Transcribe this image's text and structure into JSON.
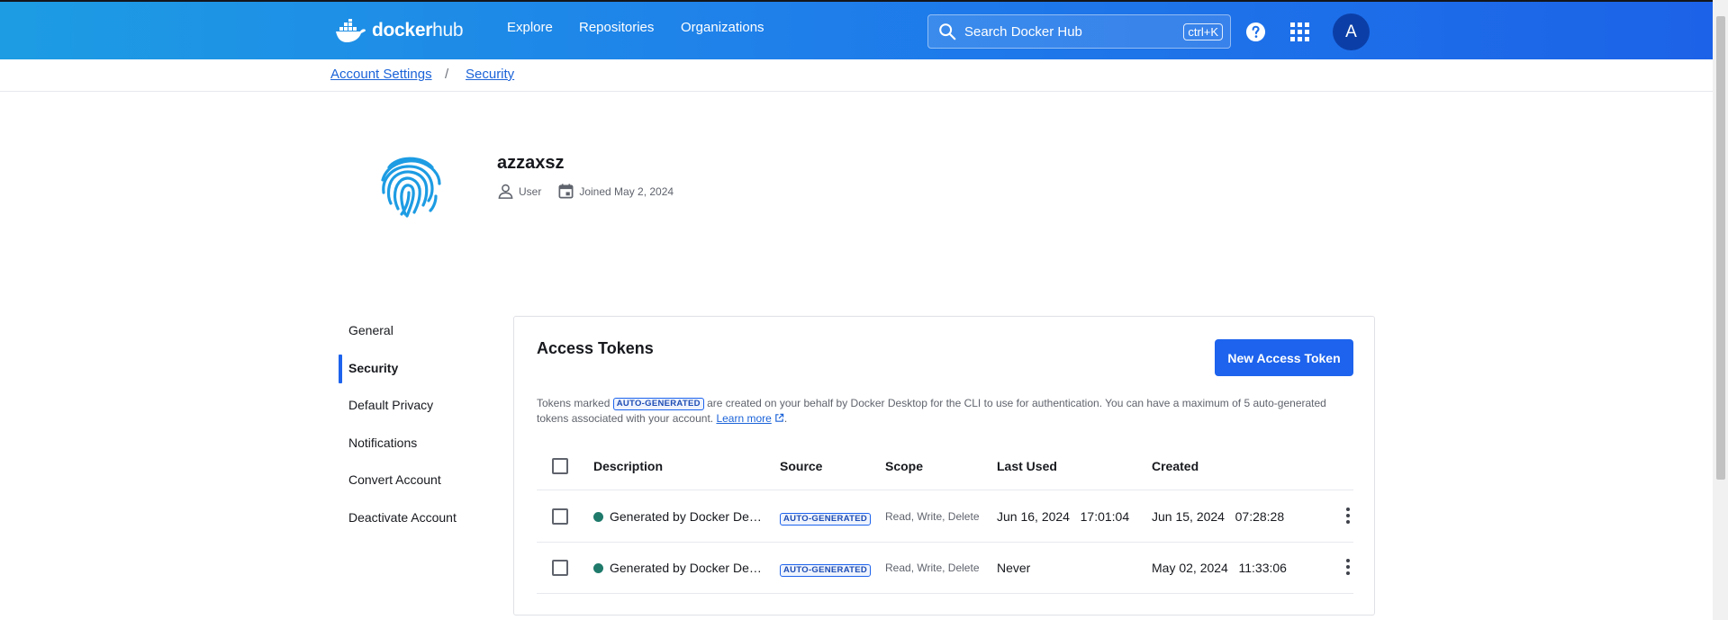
{
  "header": {
    "logo_text_1": "docker",
    "logo_text_2": "hub",
    "nav": [
      "Explore",
      "Repositories",
      "Organizations"
    ],
    "search_placeholder": "Search Docker Hub",
    "search_shortcut": "ctrl+K",
    "avatar_initial": "A",
    "icons": [
      "docker-whale-icon",
      "search-icon",
      "help-icon",
      "apps-grid-icon"
    ]
  },
  "breadcrumb": {
    "items": [
      "Account Settings",
      "Security"
    ],
    "separator": "/"
  },
  "profile": {
    "username": "azzaxsz",
    "role": "User",
    "joined": "Joined May 2, 2024",
    "icons": [
      "fingerprint-icon",
      "user-icon",
      "calendar-icon"
    ]
  },
  "sidebar": {
    "items": [
      "General",
      "Security",
      "Default Privacy",
      "Notifications",
      "Convert Account",
      "Deactivate Account"
    ],
    "active": "Security"
  },
  "tokens": {
    "title": "Access Tokens",
    "new_button": "New Access Token",
    "info_before": "Tokens marked",
    "badge": "AUTO-GENERATED",
    "info_after": "are created on your behalf by Docker Desktop for the CLI to use for authentication. You can have a maximum of 5 auto-generated tokens associated with your account.",
    "learn_more": "Learn more",
    "info_end": ".",
    "columns": [
      "Description",
      "Source",
      "Scope",
      "Last Used",
      "Created"
    ],
    "rows": [
      {
        "description": "Generated by Docker De…",
        "source": "AUTO-GENERATED",
        "scope": "Read, Write, Delete",
        "last_used": "Jun 16, 2024   17:01:04",
        "created": "Jun 15, 2024   07:28:28"
      },
      {
        "description": "Generated by Docker De…",
        "source": "AUTO-GENERATED",
        "scope": "Read, Write, Delete",
        "last_used": "Never",
        "created": "May 02, 2024   11:33:06"
      }
    ]
  },
  "colors": {
    "primary": "#1d63ed",
    "header_gradient_start": "#1d9ce3",
    "header_gradient_end": "#1c62e8",
    "active_status": "#1f7a6b",
    "fingerprint": "#1d9ce3"
  }
}
